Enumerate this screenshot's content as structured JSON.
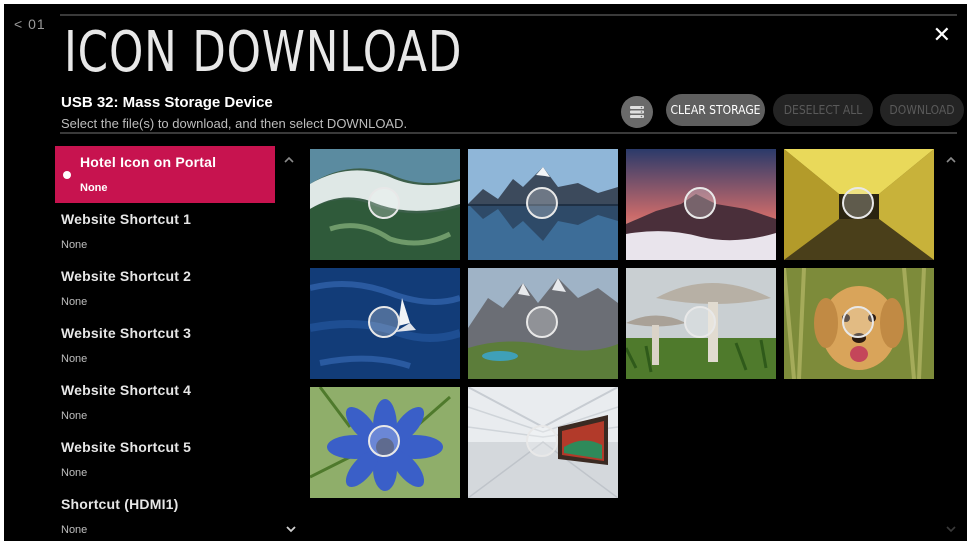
{
  "header": {
    "back_label": "< 01",
    "title": "ICON DOWNLOAD",
    "device": "USB 32: Mass Storage Device",
    "instruction": "Select the file(s) to download, and then select DOWNLOAD."
  },
  "toolbar": {
    "clear_storage": "CLEAR STORAGE",
    "deselect_all": "DESELECT ALL",
    "download": "DOWNLOAD"
  },
  "menu": {
    "items": [
      {
        "label": "Hotel Icon on Portal",
        "value": "None",
        "selected": true
      },
      {
        "label": "Website Shortcut 1",
        "value": "None"
      },
      {
        "label": "Website Shortcut 2",
        "value": "None"
      },
      {
        "label": "Website Shortcut 3",
        "value": "None"
      },
      {
        "label": "Website Shortcut 4",
        "value": "None"
      },
      {
        "label": "Website Shortcut 5",
        "value": "None"
      },
      {
        "label": "Shortcut (HDMI1)",
        "value": "None"
      }
    ]
  },
  "icons": {
    "close": "close-icon",
    "storage": "storage-icon",
    "selected_dot": "selected-dot-icon",
    "scroll_up": "chevron-up-icon",
    "scroll_down": "chevron-down-icon"
  },
  "colors": {
    "selected": "#c7134f",
    "background": "#000000",
    "button": "#5f5f5f",
    "button_disabled": "#242424"
  },
  "images": [
    {
      "name": "image-aerial-coast"
    },
    {
      "name": "image-mountain-lake"
    },
    {
      "name": "image-volcano-clouds"
    },
    {
      "name": "image-yellow-tunnel"
    },
    {
      "name": "image-sailboat-ocean"
    },
    {
      "name": "image-rocky-peaks"
    },
    {
      "name": "image-mushrooms"
    },
    {
      "name": "image-golden-retriever"
    },
    {
      "name": "image-blue-flower"
    },
    {
      "name": "image-terminal-hall"
    }
  ]
}
